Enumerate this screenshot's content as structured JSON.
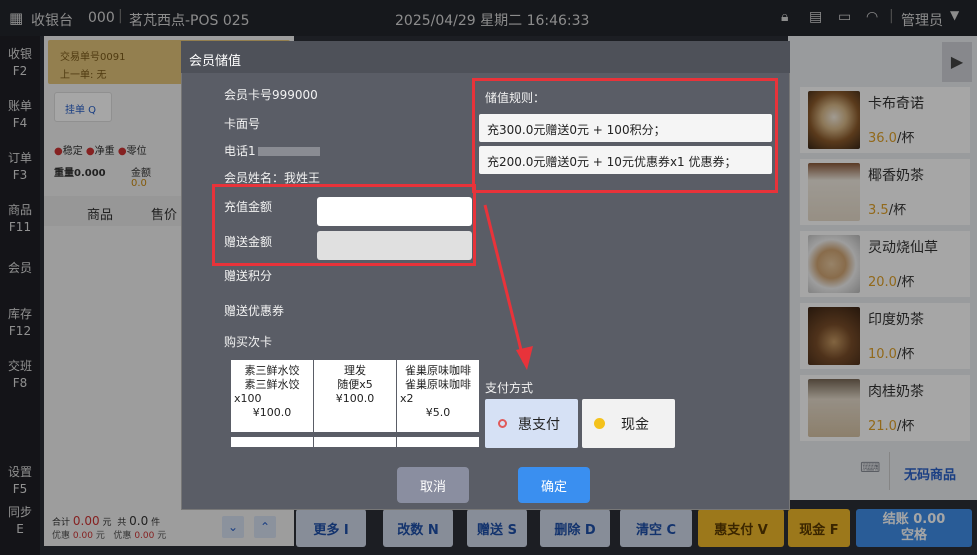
{
  "topbar": {
    "app": "收银台",
    "code": "000",
    "store": "茗芃西点-POS 025",
    "datetime": "2025/04/29 星期二 16:46:33",
    "user": "管理员"
  },
  "sidebar": [
    "收银",
    "F2",
    "账单",
    "F4",
    "订单",
    "F3",
    "商品",
    "F11",
    "会员",
    "库存",
    "F12",
    "交班",
    "F8",
    "设置",
    "F5",
    "同步",
    "E"
  ],
  "left": {
    "txn": "交易单号0091",
    "prev": "上一单: 无",
    "tag": "挂单 Q",
    "stable": "稳定",
    "net": "净重",
    "zero": "零位",
    "weight": "重量0.000",
    "amount_label": "金额",
    "amount": "0.0",
    "col_product": "商品",
    "col_price": "售价",
    "total_label": "合计",
    "total": "0.00",
    "total_unit": "元",
    "count_label": "共",
    "count": "0.0",
    "count_unit": "件",
    "discount_label": "优惠",
    "discount": "0.00",
    "discount_unit": "元",
    "coupon_label": "优惠",
    "coupon": "0.00",
    "coupon_unit": "元"
  },
  "products": [
    {
      "name": "卡布奇诺",
      "price": "36.0",
      "unit": "/杯"
    },
    {
      "name": "椰香奶茶",
      "price": "3.5",
      "unit": "/杯"
    },
    {
      "name": "灵动烧仙草",
      "price": "20.0",
      "unit": "/杯"
    },
    {
      "name": "印度奶茶",
      "price": "10.0",
      "unit": "/杯"
    },
    {
      "name": "肉桂奶茶",
      "price": "21.0",
      "unit": "/杯"
    }
  ],
  "nocode": "无码商品",
  "bottom": [
    "更多 I",
    "改数 N",
    "赠送 S",
    "删除 D",
    "清空 C",
    "惠支付 V",
    "现金 F"
  ],
  "checkout": {
    "line1": "结账 0.00",
    "line2": "空格"
  },
  "dialog": {
    "title": "会员储值",
    "card_no": "会员卡号999000",
    "card_face": "卡面号",
    "phone": "电话1",
    "name": "会员姓名：我姓王",
    "recharge_label": "充值金额",
    "gift_label": "赠送金额",
    "points_label": "赠送积分",
    "coupon_label": "赠送优惠券",
    "buycard_label": "购买次卡",
    "rules_title": "储值规则：",
    "rules": [
      "充300.0元赠送0元 + 100积分；",
      "充200.0元赠送0元 + 10元优惠券x1 优惠券；"
    ],
    "cards": [
      {
        "l1": "素三鲜水饺",
        "l2": "素三鲜水饺",
        "l3": "x100",
        "price": "¥100.0"
      },
      {
        "l1": "理发",
        "l2": "随便x5",
        "l3": "",
        "price": "¥100.0"
      },
      {
        "l1": "雀巢原味咖啡",
        "l2": "雀巢原味咖啡",
        "l3": "x2",
        "price": "¥5.0"
      }
    ],
    "pay_title": "支付方式",
    "pay": [
      "惠支付",
      "现金"
    ],
    "cancel": "取消",
    "confirm": "确定"
  }
}
